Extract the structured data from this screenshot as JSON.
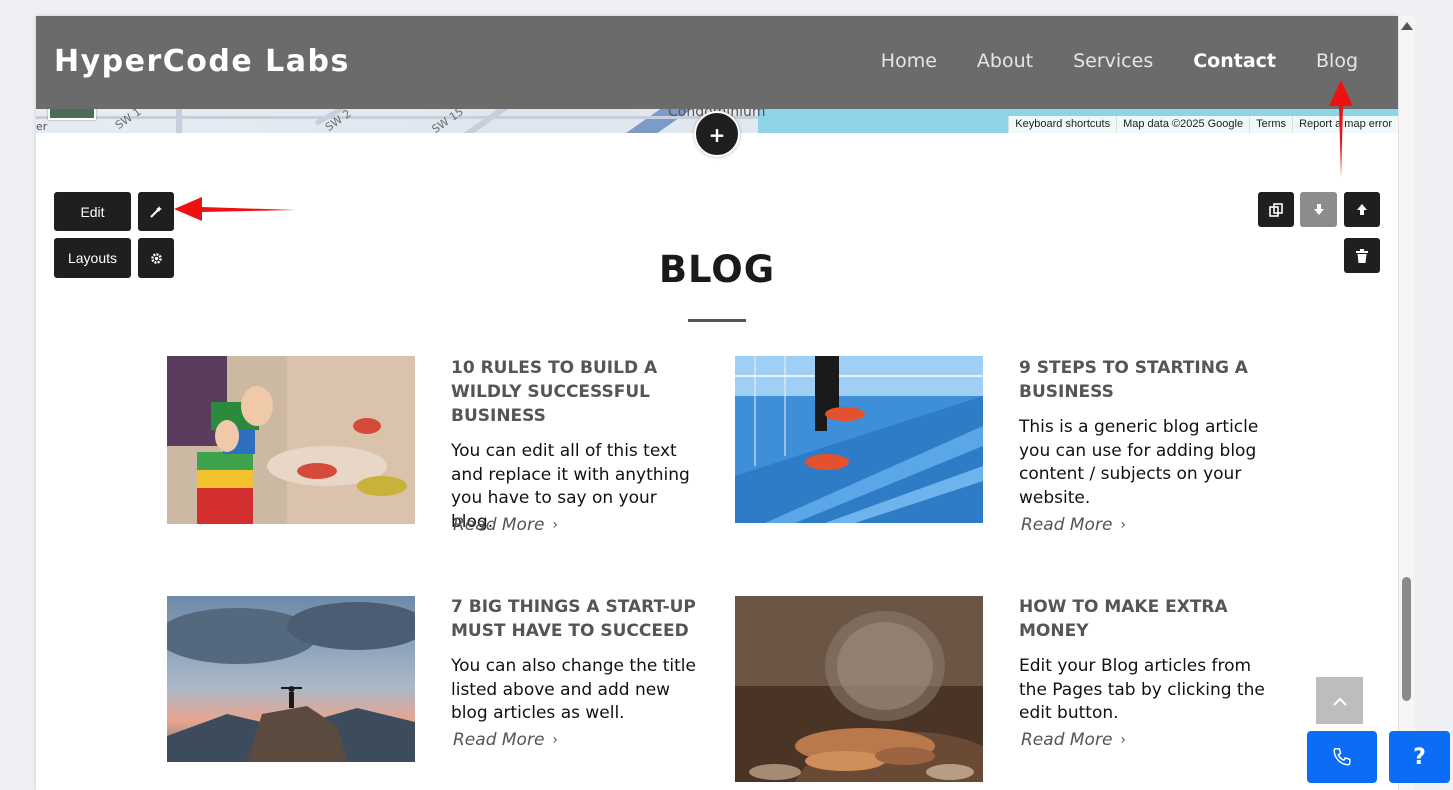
{
  "site": {
    "brand": "HyperCode Labs",
    "nav": [
      {
        "label": "Home",
        "active": false
      },
      {
        "label": "About",
        "active": false
      },
      {
        "label": "Services",
        "active": false
      },
      {
        "label": "Contact",
        "active": true
      },
      {
        "label": "Blog",
        "active": false
      }
    ]
  },
  "map": {
    "poi_label": "Condominium",
    "streets": [
      "SW 1",
      "SW 2",
      "SW 15"
    ],
    "edge_text": "er",
    "attribution": [
      "Keyboard shortcuts",
      "Map data ©2025 Google",
      "Terms",
      "Report a map error"
    ]
  },
  "editor": {
    "add_section_label": "+",
    "edit_label": "Edit",
    "layouts_label": "Layouts",
    "magic_icon": "magic-wand-icon",
    "settings_icon": "gear-icon",
    "copy_icon": "copy-icon",
    "move_down_icon": "arrow-down-icon",
    "move_up_icon": "arrow-up-icon",
    "delete_icon": "trash-icon"
  },
  "blog": {
    "heading": "BLOG",
    "read_more": "Read More",
    "posts": [
      {
        "title": "10 RULES TO BUILD A WILDLY SUCCESSFUL BUSINESS",
        "body": "You can edit all of this text and replace it with anything you have to say on your blog.",
        "image": "toy-blocks-photo"
      },
      {
        "title": "9 STEPS TO STARTING A BUSINESS",
        "body": "This is a generic blog article you can use for adding blog content / subjects on your website.",
        "image": "blue-stairs-photo"
      },
      {
        "title": "7 BIG THINGS A START-UP MUST HAVE TO SUCCEED",
        "body": "You can also change the title listed above and add new blog articles as well.",
        "image": "mountain-summit-photo"
      },
      {
        "title": "HOW TO MAKE EXTRA MONEY",
        "body": "Edit your Blog articles from the Pages tab by clicking the edit button.",
        "image": "coin-jar-photo"
      }
    ]
  },
  "floating": {
    "help_label": "?",
    "phone_icon": "phone-icon",
    "scroll_top_icon": "chevron-up-icon"
  },
  "colors": {
    "header_bg": "#6b6b6b",
    "accent_blue": "#0b6cf5",
    "annotation_red": "#ee1111"
  }
}
